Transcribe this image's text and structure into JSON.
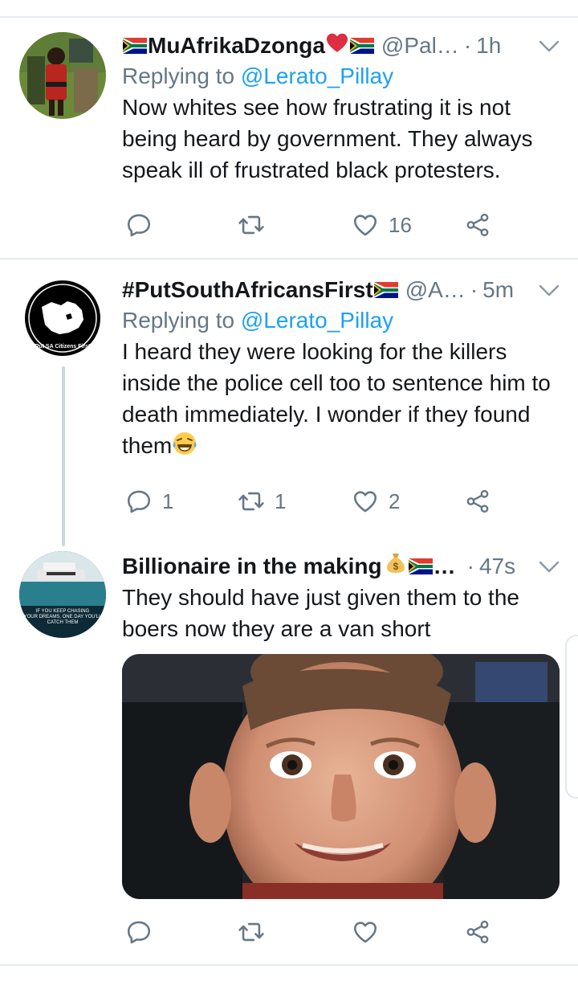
{
  "tweets": [
    {
      "name": "MuAfrikaDzonga",
      "handle": "@Pal…",
      "dot": "·",
      "time": "1h",
      "replying_prefix": "Replying to",
      "replying_handle": "@Lerato_Pillay",
      "text": "Now whites see how frustrating it is not being heard by government. They always speak ill of frustrated black protesters.",
      "counts": {
        "reply": "",
        "retweet": "",
        "like": "16"
      }
    },
    {
      "name": "#PutSouthAfricansFirst",
      "handle": "@A…",
      "dot": "·",
      "time": "5m",
      "replying_prefix": "Replying to",
      "replying_handle": "@Lerato_Pillay",
      "text": "I heard they were looking for the killers inside the police cell too to sentence him to death immediately. I wonder if they found them",
      "avatar_text": "Put SA Citizens First",
      "counts": {
        "reply": "1",
        "retweet": "1",
        "like": "2"
      }
    },
    {
      "name": "Billionaire in the making",
      "ellipsis": "…",
      "dot": "·",
      "time": "47s",
      "text": "They should have just given them to the boers now they are a van short",
      "avatar_text_1": "IF YOU KEEP CHASING",
      "avatar_text_2": "YOUR DREAMS, ONE DAY YOU'LL",
      "avatar_text_3": "CATCH THEM",
      "counts": {
        "reply": "",
        "retweet": "",
        "like": ""
      }
    }
  ],
  "icons": [
    "za-flag-icon",
    "red-heart-icon",
    "money-bag-icon",
    "laughing-tears-icon",
    "reply-icon",
    "retweet-icon",
    "like-icon",
    "share-icon",
    "chevron-down-icon"
  ],
  "colors": {
    "link": "#1da1f2",
    "secondary_text": "#657786",
    "divider": "#e6ecf0",
    "thread_line": "#ccd6dd"
  }
}
